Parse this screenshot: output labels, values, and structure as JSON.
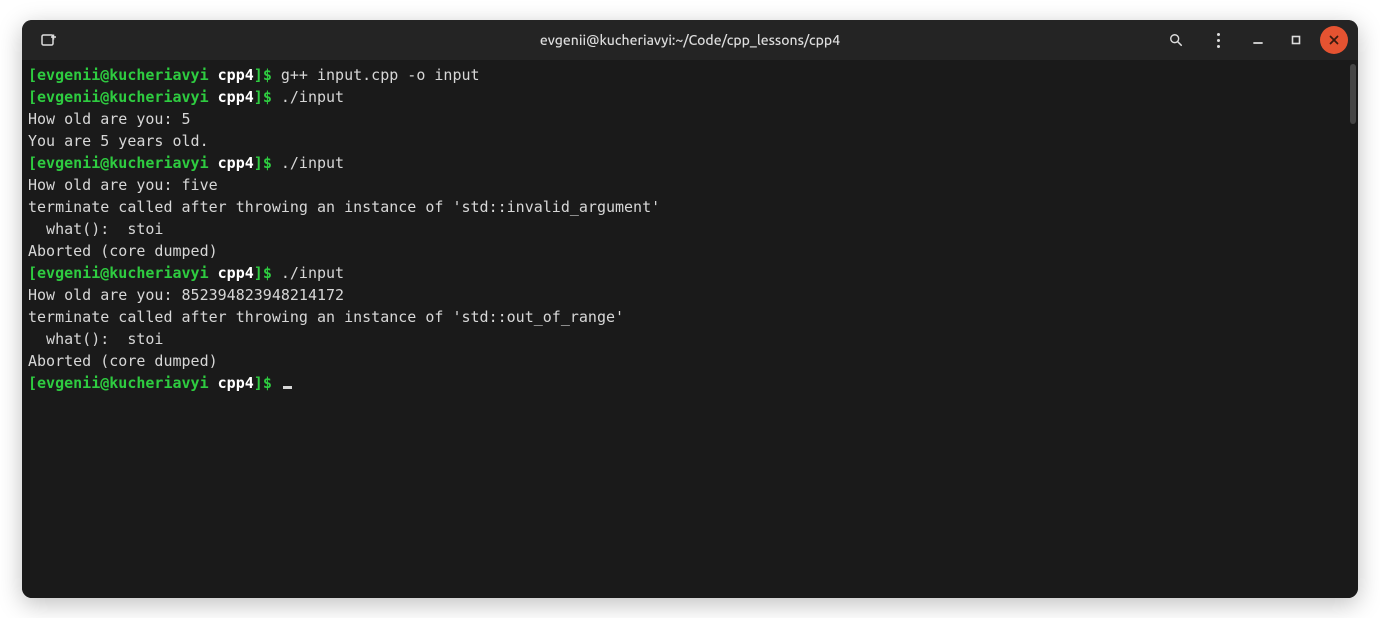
{
  "titlebar": {
    "title": "evgenii@kucheriavyi:~/Code/cpp_lessons/cpp4"
  },
  "prompt": {
    "open": "[",
    "user": "evgenii@kucheriavyi",
    "folder": "cpp4",
    "close": "]",
    "dollar": "$"
  },
  "lines": [
    {
      "type": "prompt",
      "cmd": "g++ input.cpp -o input"
    },
    {
      "type": "prompt",
      "cmd": "./input"
    },
    {
      "type": "out",
      "text": "How old are you: 5"
    },
    {
      "type": "out",
      "text": "You are 5 years old."
    },
    {
      "type": "prompt",
      "cmd": "./input"
    },
    {
      "type": "out",
      "text": "How old are you: five"
    },
    {
      "type": "out",
      "text": "terminate called after throwing an instance of 'std::invalid_argument'"
    },
    {
      "type": "out",
      "text": "  what():  stoi"
    },
    {
      "type": "out",
      "text": "Aborted (core dumped)"
    },
    {
      "type": "prompt",
      "cmd": "./input"
    },
    {
      "type": "out",
      "text": "How old are you: 852394823948214172"
    },
    {
      "type": "out",
      "text": "terminate called after throwing an instance of 'std::out_of_range'"
    },
    {
      "type": "out",
      "text": "  what():  stoi"
    },
    {
      "type": "out",
      "text": "Aborted (core dumped)"
    },
    {
      "type": "prompt",
      "cmd": "",
      "cursor": true
    }
  ]
}
